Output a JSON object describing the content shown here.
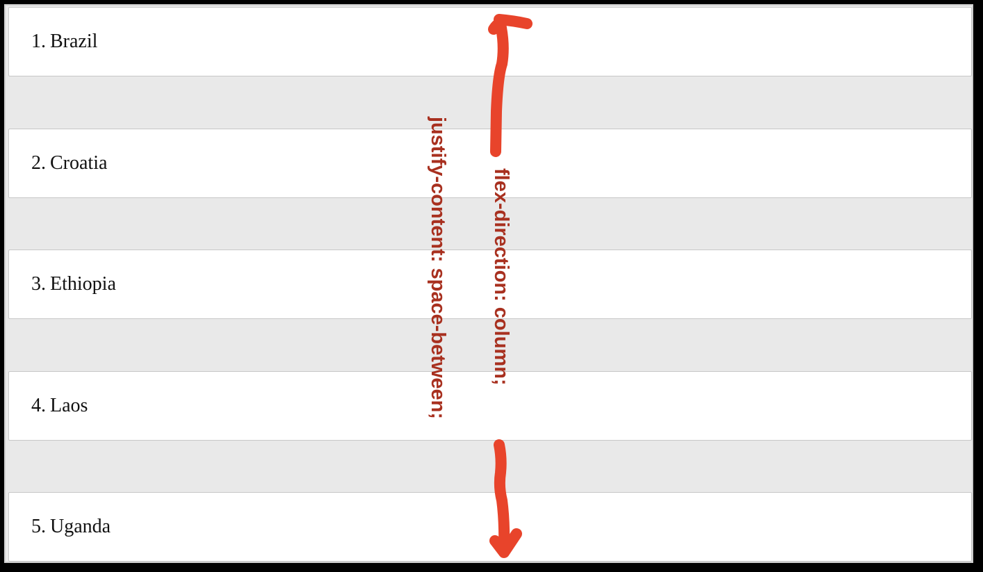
{
  "items": [
    {
      "num": "1.",
      "name": "Brazil"
    },
    {
      "num": "2.",
      "name": "Croatia"
    },
    {
      "num": "3.",
      "name": "Ethiopia"
    },
    {
      "num": "4.",
      "name": "Laos"
    },
    {
      "num": "5.",
      "name": "Uganda"
    }
  ],
  "annotations": {
    "justify": "justify-content: space-between;",
    "direction": "flex-direction: column;"
  },
  "colors": {
    "arrow": "#e8442b",
    "annotation_text": "#a8301f",
    "container_bg": "#e9e9e9",
    "item_bg": "#ffffff"
  },
  "icons": {
    "arrow": "double-headed-vertical-arrow"
  }
}
